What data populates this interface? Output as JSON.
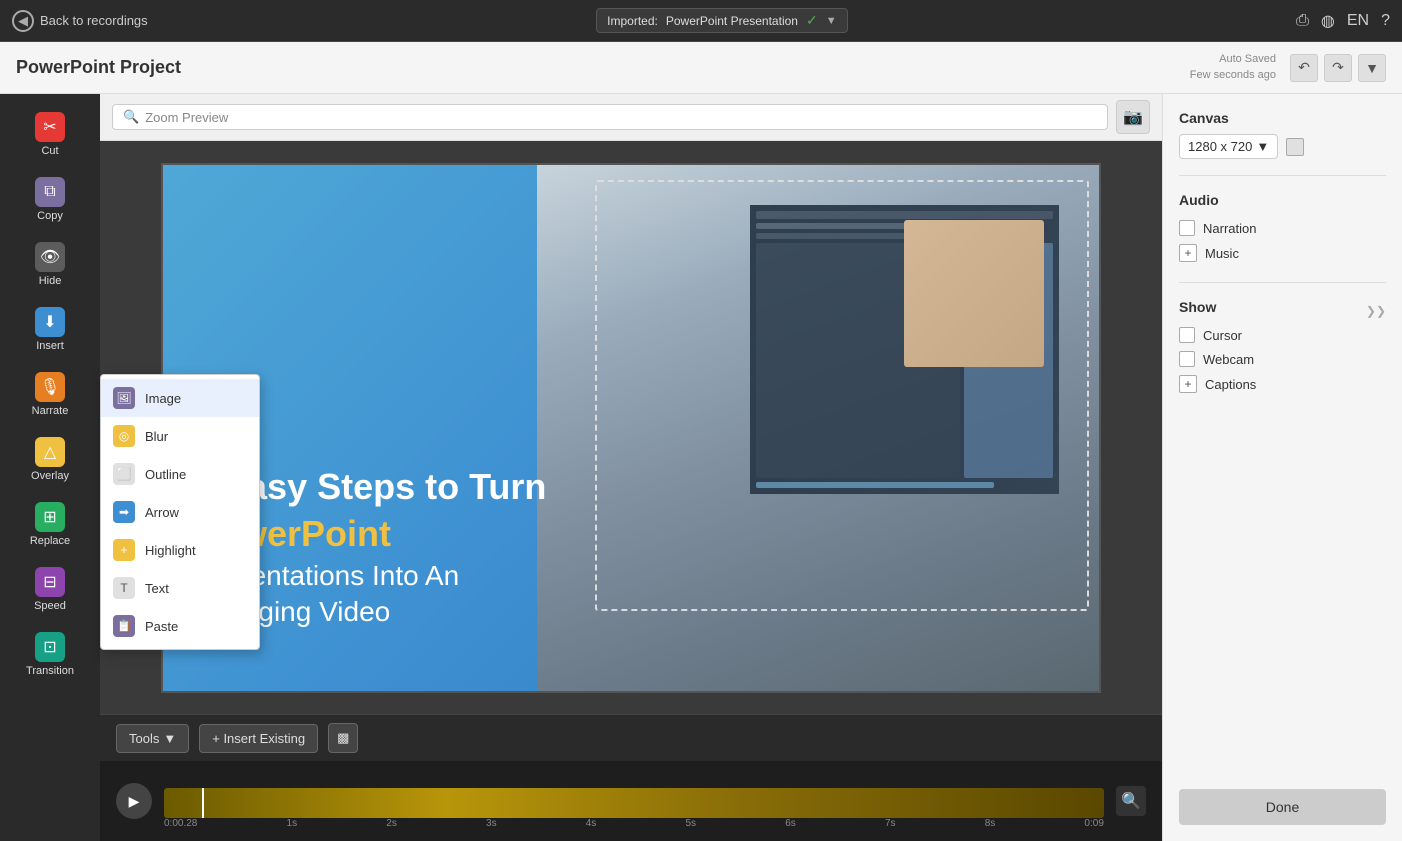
{
  "topbar": {
    "back_label": "Back to recordings",
    "imported_label": "Imported:",
    "imported_value": "PowerPoint Presentation",
    "lang": "EN"
  },
  "titlebar": {
    "project_title": "PowerPoint Project",
    "auto_saved_label": "Auto Saved",
    "saved_time": "Few seconds ago"
  },
  "canvas_toolbar": {
    "search_placeholder": "Zoom Preview",
    "screenshot_icon": "📷"
  },
  "slide": {
    "text_line1": "5 Easy Steps to Turn",
    "text_line2": "PowerPoint",
    "text_line3": "Presentations Into An",
    "text_line4": "Engaging Video"
  },
  "context_menu": {
    "items": [
      {
        "id": "image",
        "label": "Image",
        "icon": "🖼"
      },
      {
        "id": "blur",
        "label": "Blur",
        "icon": "◎"
      },
      {
        "id": "outline",
        "label": "Outline",
        "icon": "⬜"
      },
      {
        "id": "arrow",
        "label": "Arrow",
        "icon": "➡"
      },
      {
        "id": "highlight",
        "label": "Highlight",
        "icon": "+"
      },
      {
        "id": "text",
        "label": "Text",
        "icon": "T"
      },
      {
        "id": "paste",
        "label": "Paste",
        "icon": "📋"
      }
    ]
  },
  "left_sidebar": {
    "items": [
      {
        "id": "cut",
        "label": "Cut",
        "icon": "✂"
      },
      {
        "id": "copy",
        "label": "Copy",
        "icon": "⧉"
      },
      {
        "id": "hide",
        "label": "Hide",
        "icon": "👁"
      },
      {
        "id": "insert",
        "label": "Insert",
        "icon": "⬇"
      },
      {
        "id": "narrate",
        "label": "Narrate",
        "icon": "🎙"
      },
      {
        "id": "overlay",
        "label": "Overlay",
        "icon": "△"
      },
      {
        "id": "replace",
        "label": "Replace",
        "icon": "⊞"
      },
      {
        "id": "speed",
        "label": "Speed",
        "icon": "⊟"
      },
      {
        "id": "transition",
        "label": "Transition",
        "icon": "⊡"
      }
    ]
  },
  "bottom_toolbar": {
    "tools_label": "Tools",
    "insert_existing_label": "+ Insert Existing"
  },
  "timeline": {
    "time_marks": [
      "0:00.28",
      "1s",
      "2s",
      "3s",
      "4s",
      "5s",
      "6s",
      "7s",
      "8s",
      "0:09"
    ],
    "current_time": "0:00.28"
  },
  "right_panel": {
    "canvas_title": "Canvas",
    "canvas_size": "1280 x 720",
    "audio_title": "Audio",
    "narration_label": "Narration",
    "music_label": "Music",
    "show_title": "Show",
    "cursor_label": "Cursor",
    "webcam_label": "Webcam",
    "captions_label": "Captions",
    "done_label": "Done"
  }
}
